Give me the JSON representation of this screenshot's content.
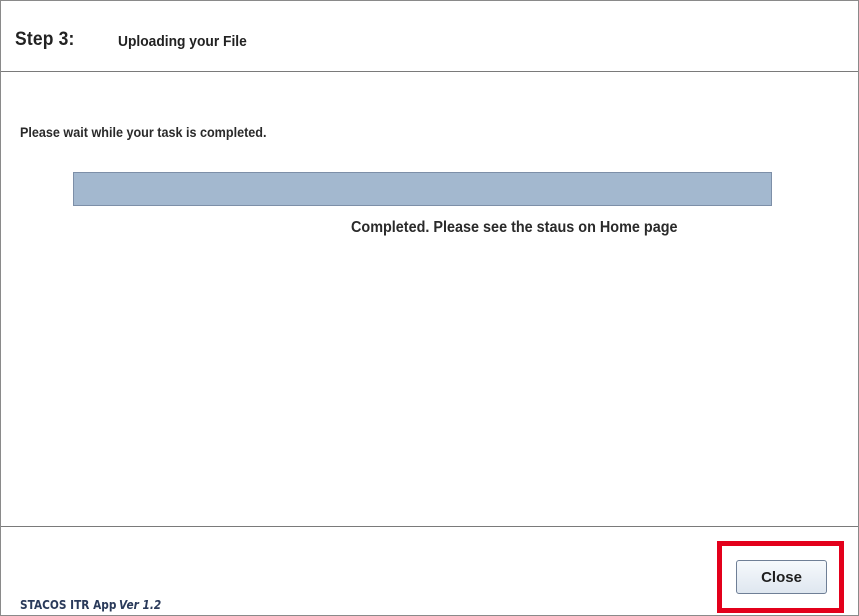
{
  "header": {
    "step_label": "Step 3:",
    "step_title": "Uploading your File"
  },
  "content": {
    "wait_message": "Please wait while your task is completed.",
    "progress": 1.0,
    "status_message": "Completed. Please see the staus on Home page"
  },
  "footer": {
    "app_name": "STACOS ITR App",
    "app_version": "Ver 1.2",
    "close_label": "Close"
  },
  "colors": {
    "progress_fill": "#a3b8cf",
    "highlight": "#e3001b"
  }
}
